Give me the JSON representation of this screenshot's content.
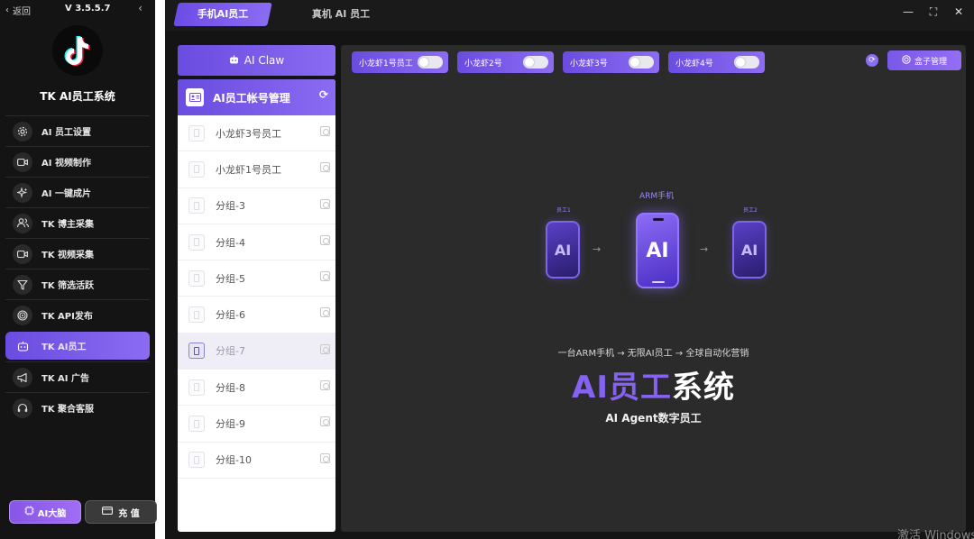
{
  "sidebar": {
    "back_label": "返回",
    "version": "V 3.5.5.7",
    "collapse_icon": "chevron-left-icon",
    "logo_icon": "tiktok-logo",
    "system_name": "TK AI员工系统",
    "menu": [
      {
        "label": "AI 员工设置",
        "icon": "gear-icon",
        "active": false
      },
      {
        "label": "AI 视频制作",
        "icon": "video-camera-icon",
        "active": false
      },
      {
        "label": "AI 一键成片",
        "icon": "sparkle-icon",
        "active": false
      },
      {
        "label": "TK 博主采集",
        "icon": "users-icon",
        "active": false
      },
      {
        "label": "TK 视频采集",
        "icon": "video-camera-icon",
        "active": false
      },
      {
        "label": "TK 筛选活跃",
        "icon": "filter-icon",
        "active": false
      },
      {
        "label": "TK API发布",
        "icon": "target-icon",
        "active": false
      },
      {
        "label": "TK AI员工",
        "icon": "robot-icon",
        "active": true
      },
      {
        "label": "TK AI 广告",
        "icon": "megaphone-icon",
        "active": false
      },
      {
        "label": "TK 聚合客服",
        "icon": "headset-icon",
        "active": false
      }
    ],
    "brain_button": "AI大脑",
    "recharge_button": "充 值"
  },
  "tabs": {
    "active": "手机AI员工",
    "inactive": "真机 AI 员工"
  },
  "window_controls": {
    "minimize": "—",
    "maximize": "⛶",
    "close": "✕"
  },
  "claw_button": "AI Claw",
  "account_panel": {
    "title": "AI员工帐号管理",
    "rows": [
      {
        "label": "小龙虾3号员工",
        "selected": false
      },
      {
        "label": "小龙虾1号员工",
        "selected": false
      },
      {
        "label": "分组-3",
        "selected": false
      },
      {
        "label": "分组-4",
        "selected": false
      },
      {
        "label": "分组-5",
        "selected": false
      },
      {
        "label": "分组-6",
        "selected": false
      },
      {
        "label": "分组-7",
        "selected": true
      },
      {
        "label": "分组-8",
        "selected": false
      },
      {
        "label": "分组-9",
        "selected": false
      },
      {
        "label": "分组-10",
        "selected": false
      }
    ]
  },
  "employees": [
    {
      "label": "小龙虾1号员工",
      "on": false
    },
    {
      "label": "小龙虾2号",
      "on": false
    },
    {
      "label": "小龙虾3号",
      "on": false
    },
    {
      "label": "小龙虾4号",
      "on": false
    }
  ],
  "box_button": "盒子管理",
  "illustration": {
    "main_label": "ARM手机",
    "left_label": "员工1",
    "right_label": "员工2",
    "phone_text": "AI",
    "arrow": "→"
  },
  "slogan": "一台ARM手机 → 无限AI员工 → 全球自动化营销",
  "big_title": {
    "purple": "AI员工",
    "white": "系统"
  },
  "subtitle": "AI Agent数字员工",
  "watermark": "激活 Windows",
  "colors": {
    "accent": "#7b5cec",
    "sidebar_bg": "#141414",
    "content_bg": "#2b2b2b"
  }
}
